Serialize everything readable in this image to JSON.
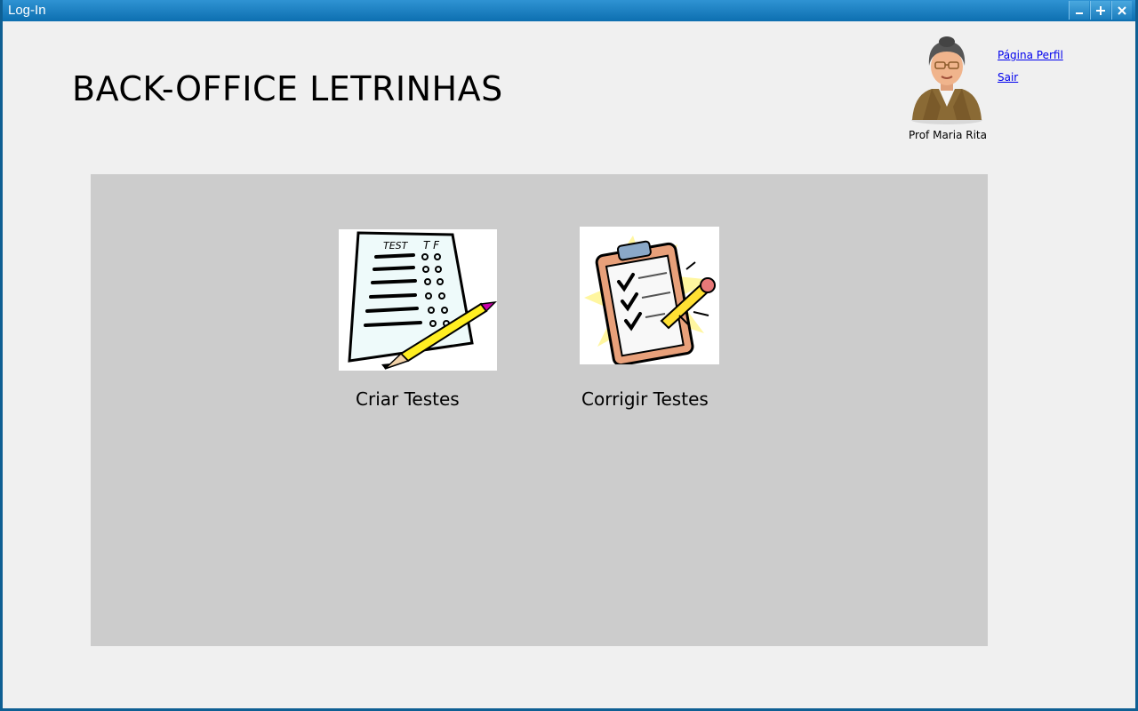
{
  "window": {
    "title": "Log-In",
    "controls": [
      "minimize-icon",
      "maximize-icon",
      "close-icon"
    ]
  },
  "header": {
    "app_title": "BACK-OFFICE LETRINHAS"
  },
  "user": {
    "name": "Prof Maria Rita",
    "links": {
      "profile": "Página Perfil",
      "logout": "Sair"
    }
  },
  "actions": [
    {
      "label": "Criar Testes",
      "icon": "test-sheet-icon"
    },
    {
      "label": "Corrigir Testes",
      "icon": "clipboard-check-icon"
    }
  ],
  "colors": {
    "titlebar": "#1a7fc0",
    "window_border": "#0e5f93",
    "background": "#f0f0f0",
    "panel": "#cccccc",
    "link": "#0000ee"
  }
}
